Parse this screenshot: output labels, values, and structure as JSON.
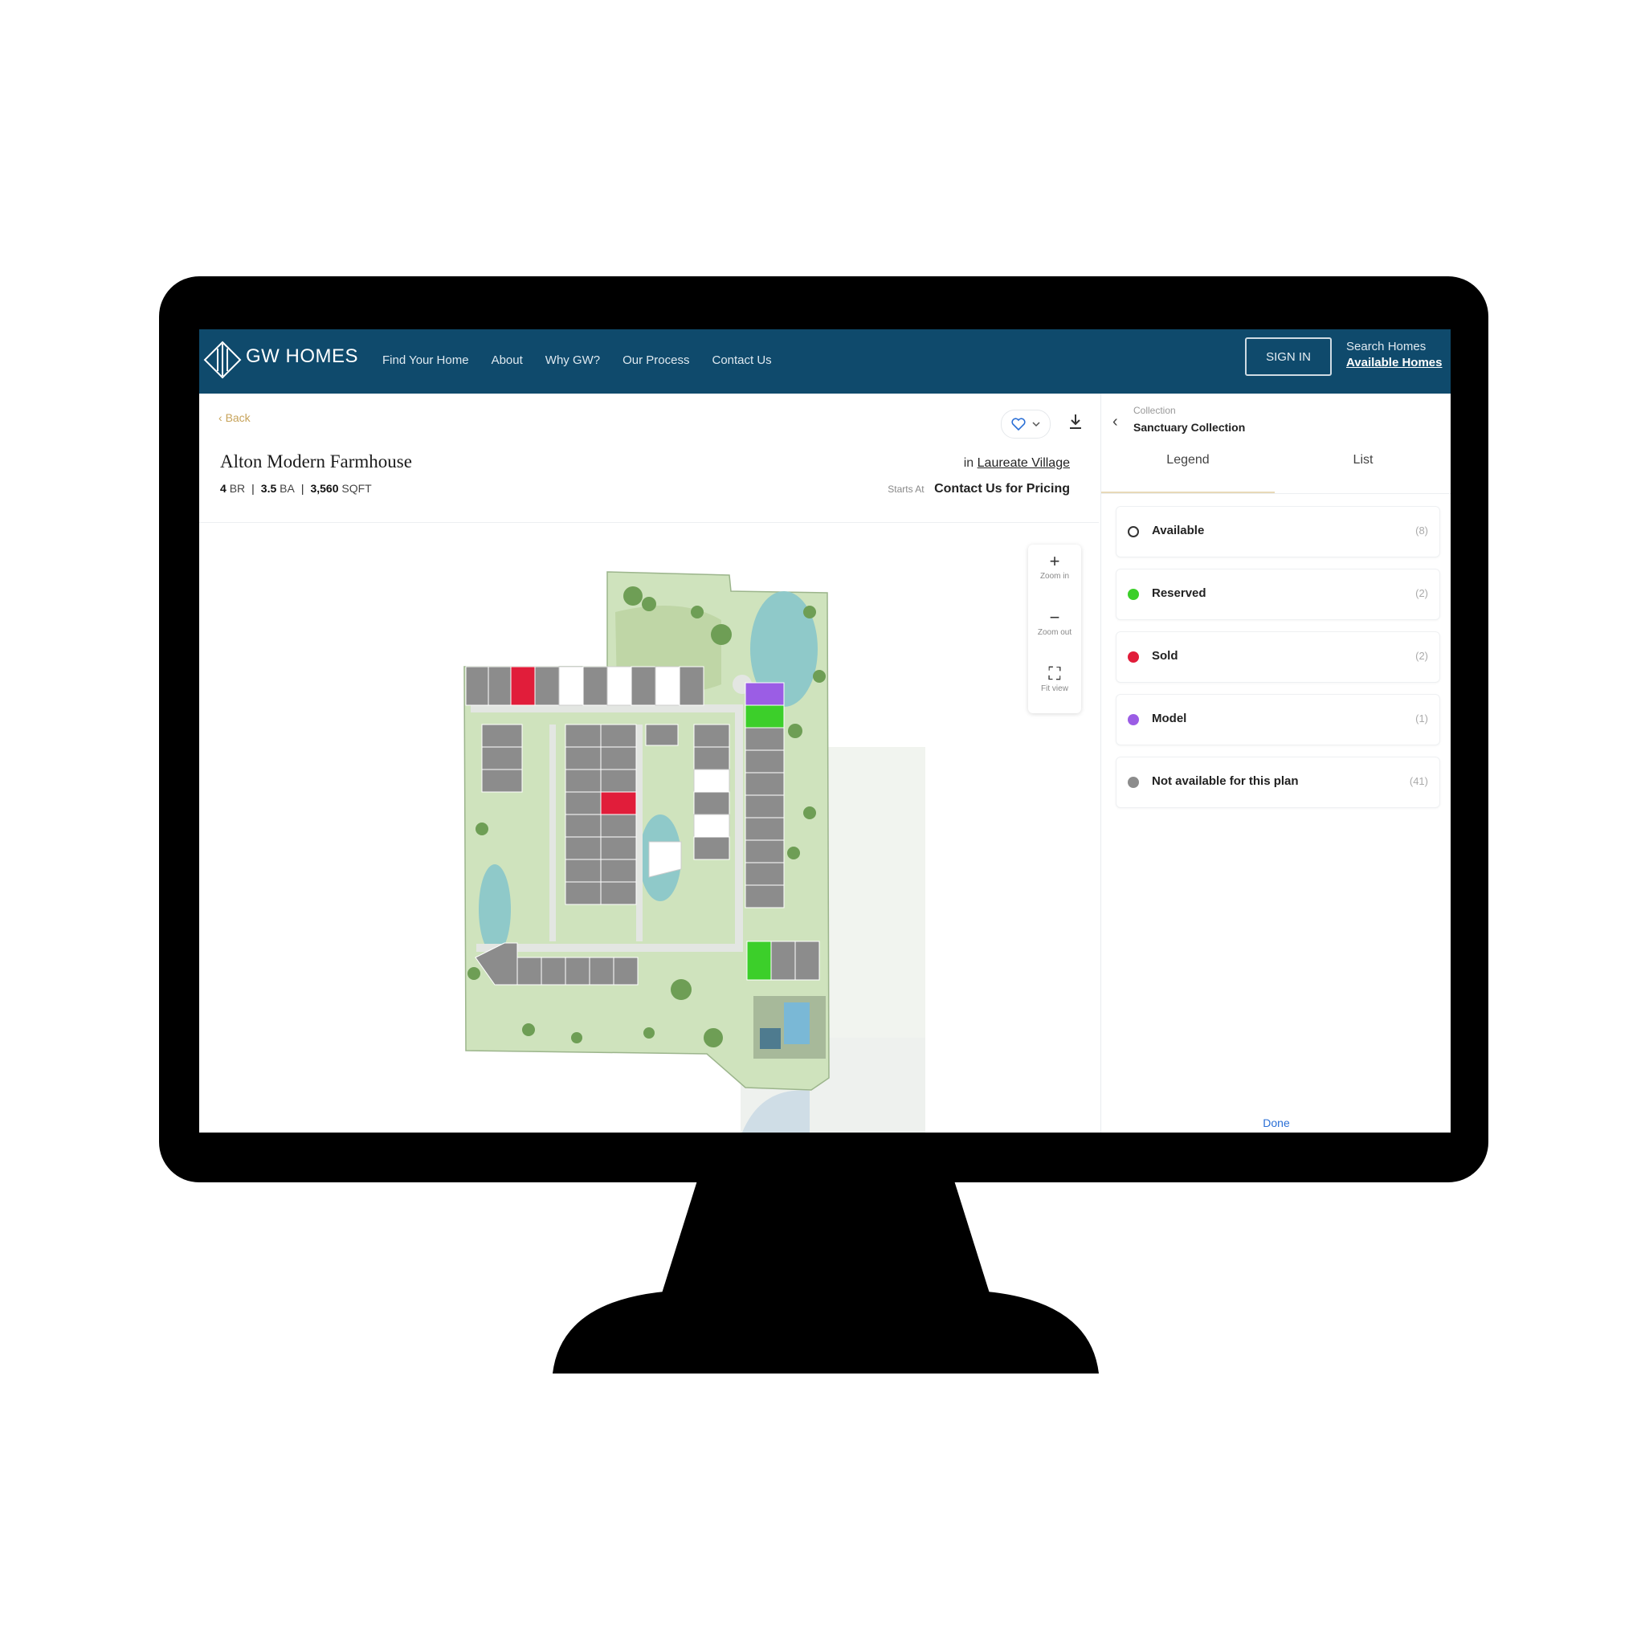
{
  "header": {
    "brand": "GW HOMES",
    "nav": [
      "Find Your Home",
      "About",
      "Why GW?",
      "Our Process",
      "Contact Us"
    ],
    "sign_in": "SIGN IN",
    "search_title": "Search Homes",
    "search_sub": "Available Homes"
  },
  "page": {
    "back_label": "Back",
    "title": "Alton Modern Farmhouse",
    "beds": "4",
    "beds_unit": "BR",
    "baths": "3.5",
    "baths_unit": "BA",
    "sqft": "3,560",
    "sqft_unit": "SQFT",
    "community_prefix": "in",
    "community": "Laureate Village",
    "price_label": "Starts At",
    "price": "Contact Us for Pricing"
  },
  "map_controls": {
    "zoom_in_label": "Zoom in",
    "zoom_out_label": "Zoom out",
    "fit_label": "Fit view"
  },
  "panel": {
    "collection_label": "Collection",
    "collection_name": "Sanctuary Collection",
    "tabs": [
      "Legend",
      "List"
    ],
    "legend": [
      {
        "label": "Available",
        "count": "(8)",
        "color": "#ffffff"
      },
      {
        "label": "Reserved",
        "count": "(2)",
        "color": "#3ccf2a"
      },
      {
        "label": "Sold",
        "count": "(2)",
        "color": "#e11d3a"
      },
      {
        "label": "Model",
        "count": "(1)",
        "color": "#9b5de5"
      },
      {
        "label": "Not available for this plan",
        "count": "(41)",
        "color": "#8c8c8c"
      }
    ],
    "done": "Done"
  },
  "colors": {
    "nav_bg": "#0f4a6c",
    "accent_gold": "#c7a35a",
    "lot_gray": "#8c8c8c",
    "grass": "#cfe3bd",
    "water": "#8fc9c9"
  }
}
